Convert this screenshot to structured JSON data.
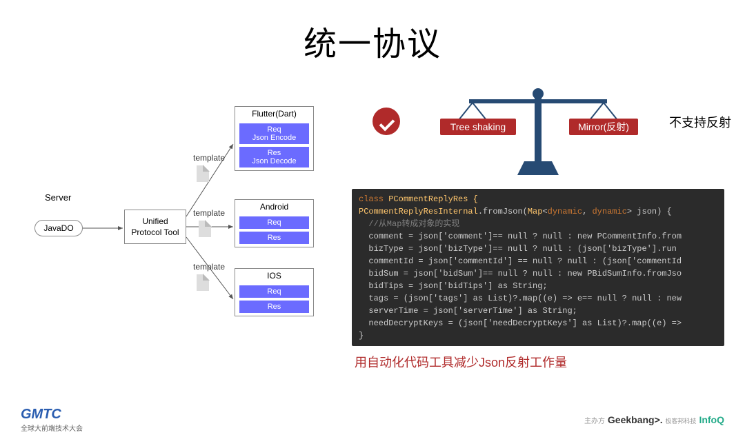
{
  "title": "统一协议",
  "diagram": {
    "server_label": "Server",
    "javado": "JavaDO",
    "tool_line1": "Unified",
    "tool_line2": "Protocol Tool",
    "template": "template",
    "platforms": {
      "flutter": {
        "title": "Flutter(Dart)",
        "req": "Req",
        "req2": "Json Encode",
        "res": "Res",
        "res2": "Json Decode"
      },
      "android": {
        "title": "Android",
        "req": "Req",
        "res": "Res"
      },
      "ios": {
        "title": "IOS",
        "req": "Req",
        "res": "Res"
      }
    }
  },
  "scale": {
    "left": "Tree shaking",
    "right": "Mirror(反射)",
    "note": "不支持反射"
  },
  "code": {
    "l1a": "class ",
    "l1b": "PCommentReplyRes {",
    "l2a": "PCommentReplyResInternal",
    "l2b": ".fromJson(",
    "l2c": "Map",
    "l2d": "<",
    "l2e": "dynamic",
    "l2f": ", ",
    "l2g": "dynamic",
    "l2h": "> json) {",
    "l3": "  //从Map转成对象的实现",
    "l4": "  comment = json['comment']== null ? null : new PCommentInfo.from",
    "l5": "  bizType = json['bizType']== null ? null : (json['bizType'].run",
    "l6": "  commentId = json['commentId'] == null ? null : (json['commentId",
    "l7": "  bidSum = json['bidSum']== null ? null : new PBidSumInfo.fromJso",
    "l8": "  bidTips = json['bidTips'] as String;",
    "l9": "  tags = (json['tags'] as List)?.map((e) => e== null ? null : new",
    "l10": "  serverTime = json['serverTime'] as String;",
    "l11": "  needDecryptKeys = (json['needDecryptKeys'] as List)?.map((e) =>",
    "l12": "}"
  },
  "caption": "用自动化代码工具减少Json反射工作量",
  "footer": {
    "gmtc": "GMTC",
    "gmtc_sub": "全球大前端技术大会",
    "sponsor_prefix": "主办方",
    "geekbang": "Geekbang>.",
    "geekbang_sub": "极客邦科技",
    "infoq": "InfoQ"
  }
}
